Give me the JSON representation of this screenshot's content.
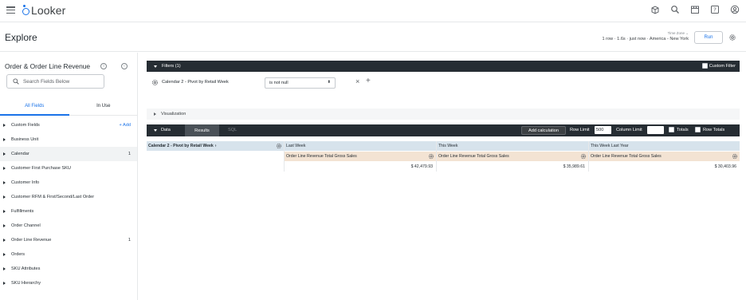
{
  "app": {
    "logo_text": "Looker",
    "brand_color": "#1a73e8",
    "top_icons": [
      "marketplace-icon",
      "search-icon",
      "store-icon",
      "help-icon",
      "account-icon"
    ]
  },
  "explore": {
    "title": "Explore",
    "timezone_label": "Time Zone ⌄",
    "run_meta": "1 row · 1.6s · just now · America - New York",
    "run_label": "Run"
  },
  "field_picker": {
    "title": "Order & Order Line Revenue",
    "search_placeholder": "Search Fields Below",
    "tabs": [
      "All Fields",
      "In Use"
    ],
    "views": [
      {
        "label": "Custom Fields",
        "count": "",
        "action": "+ Add"
      },
      {
        "label": "Business Unit",
        "count": "",
        "action": ""
      },
      {
        "label": "Calendar",
        "count": "1",
        "action": ""
      },
      {
        "label": "Customer First Purchase SKU",
        "count": "",
        "action": ""
      },
      {
        "label": "Customer Info",
        "count": "",
        "action": ""
      },
      {
        "label": "Customer RFM & First/Second/Last Order",
        "count": "",
        "action": ""
      },
      {
        "label": "Fulfillments",
        "count": "",
        "action": ""
      },
      {
        "label": "Order Channel",
        "count": "",
        "action": ""
      },
      {
        "label": "Order Line Revenue",
        "count": "1",
        "action": ""
      },
      {
        "label": "Orders",
        "count": "",
        "action": ""
      },
      {
        "label": "SKU Attributes",
        "count": "",
        "action": ""
      },
      {
        "label": "SKU Hierarchy",
        "count": "",
        "action": ""
      }
    ]
  },
  "filters": {
    "header": "Filters (1)",
    "custom_filter_label": "Custom Filter",
    "field_label": "Calendar 2 - Pivot by Retail Week",
    "operator": "is not null"
  },
  "visualization": {
    "label": "Visualization"
  },
  "data": {
    "label": "Data",
    "tabs": [
      "Results",
      "SQL"
    ],
    "add_calculation": "Add calculation",
    "row_limit_label": "Row Limit",
    "row_limit_value": "500",
    "column_limit_label": "Column Limit",
    "totals_label": "Totals",
    "row_totals_label": "Row Totals"
  },
  "results": {
    "pivot_dimension": "Calendar 2 - Pivot by Retail Week",
    "pivot_values": [
      "Last Week",
      "This Week",
      "This Week Last Year"
    ],
    "measure": "Order Line Revenue Total Gross Sales",
    "values": [
      "$ 42,479.93",
      "$ 35,989.61",
      "$ 30,403.96"
    ]
  }
}
